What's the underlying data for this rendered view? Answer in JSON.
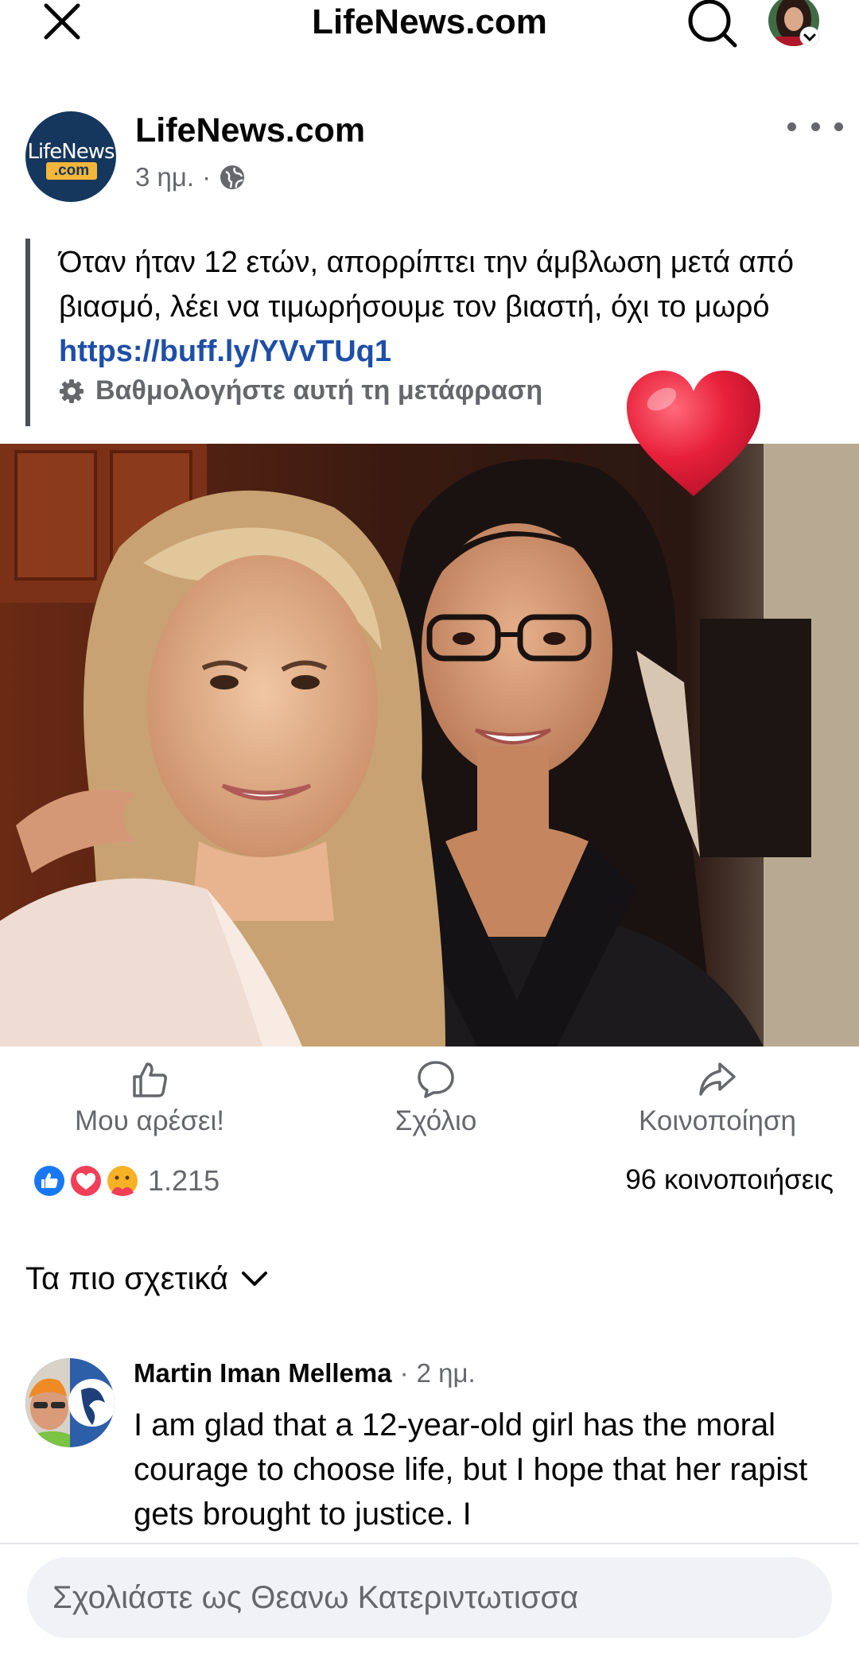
{
  "top_bar": {
    "title": "LifeNews.com",
    "close_icon": "close-icon",
    "search_icon": "search-icon"
  },
  "post": {
    "page_name": "LifeNews.com",
    "avatar_logo_line1": "LifeNews",
    "avatar_logo_line2": ".com",
    "time": "3 ημ.",
    "separator": "·",
    "privacy_icon": "globe-icon",
    "text": "Όταν ήταν 12 ετών, απορρίπτει την άμβλωση μετά από βιασμό, λέει να τιμωρήσουμε τον βιαστή, όχι το μωρό ",
    "link": "https://buff.ly/YVvTUq1",
    "translate_label": "Βαθμολογήστε αυτή τη μετάφραση"
  },
  "actions": {
    "like_label": "Μου αρέσει!",
    "comment_label": "Σχόλιο",
    "share_label": "Κοινοποίηση"
  },
  "stats": {
    "reaction_count": "1.215",
    "shares": "96 κοινοποιήσεις"
  },
  "comments": {
    "sort_label": "Τα πιο σχετικά",
    "items": [
      {
        "author": "Martin Iman Mellema",
        "separator": "·",
        "time": "2 ημ.",
        "text": "I am glad that a 12-year-old girl has the moral courage to choose life, but I hope that her rapist gets brought to justice.  I"
      }
    ]
  },
  "composer": {
    "placeholder": "Σχολιάστε ως Θεανω Κατεριντωτισσα"
  },
  "colors": {
    "link": "#1e4fa8",
    "secondary_text": "#65676b",
    "like_blue": "#1877f2",
    "love_red": "#f33e58",
    "heart_sticker": "#e8203a",
    "logo_navy": "#15365d"
  }
}
